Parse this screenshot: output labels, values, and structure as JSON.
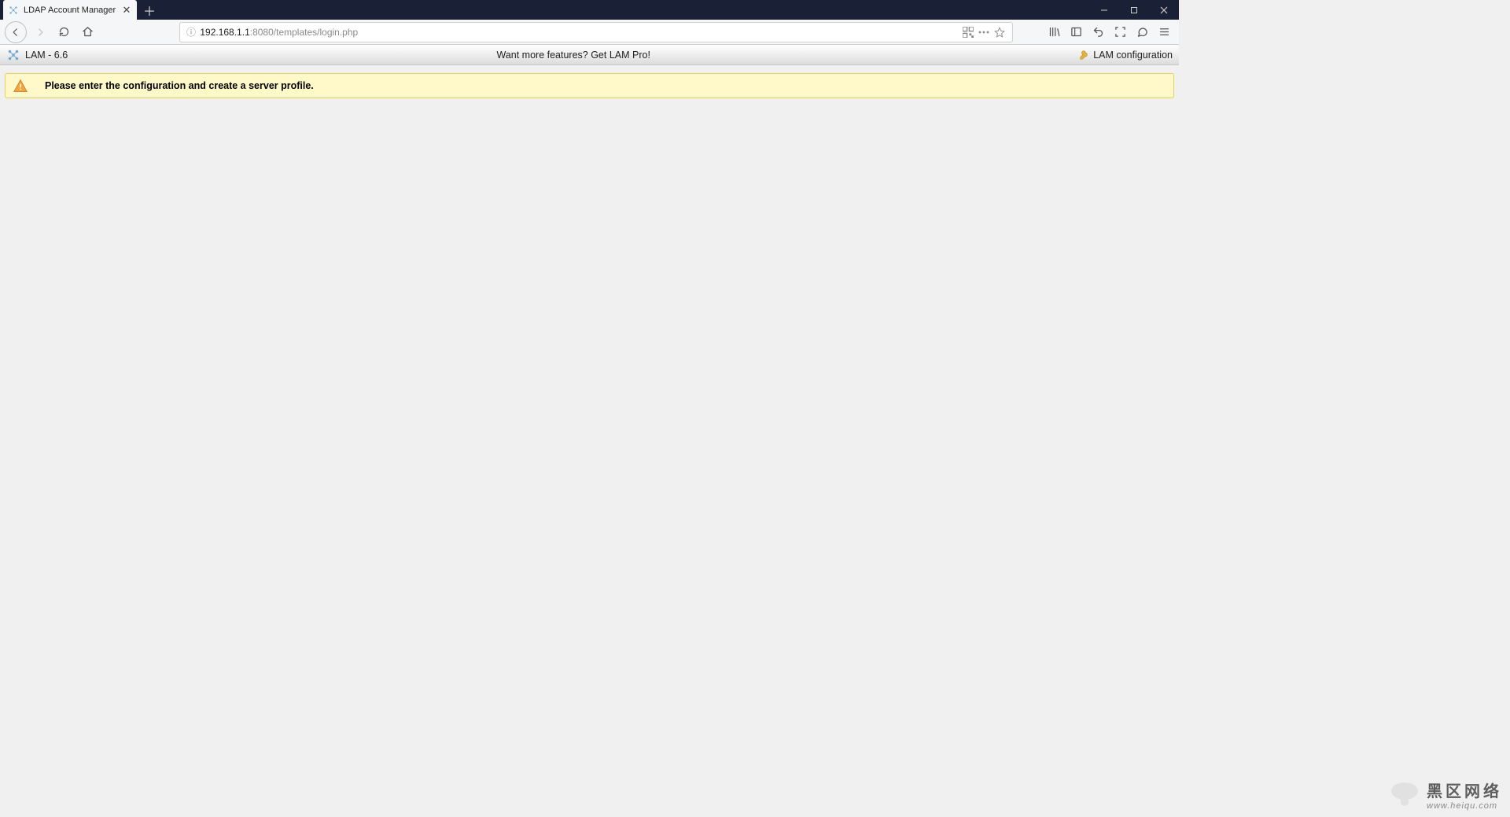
{
  "browser": {
    "tab_title": "LDAP Account Manager",
    "url_host": "192.168.1.1",
    "url_rest": ":8080/templates/login.php"
  },
  "lam": {
    "version_label": "LAM - 6.6",
    "promo_text": "Want more features? Get LAM Pro!",
    "config_label": "LAM configuration",
    "alert_message": "Please enter the configuration and create a server profile."
  },
  "watermark": {
    "title": "黑区网络",
    "subtitle": "www.heiqu.com"
  }
}
